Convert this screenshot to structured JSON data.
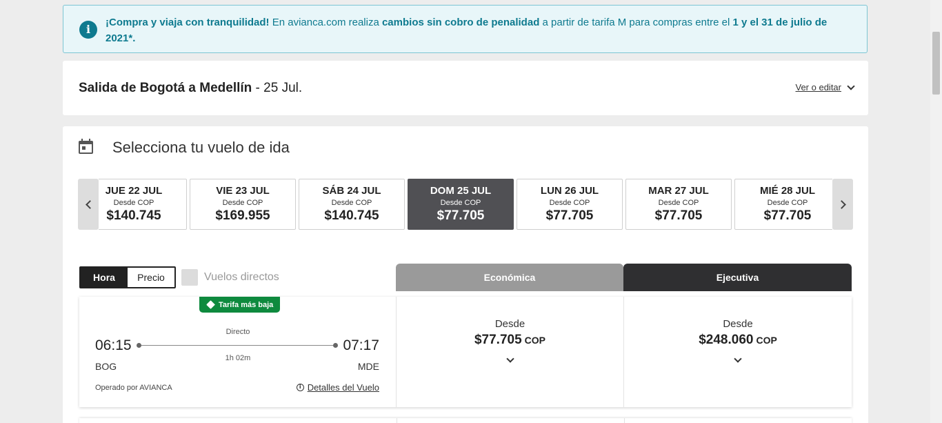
{
  "banner": {
    "part1": "¡Compra y viaja con tranquilidad!",
    "part2": " En avianca.com realiza ",
    "part3": "cambios sin cobro de penalidad",
    "part4": " a partir de tarifa M para compras entre el ",
    "part5": "1 y el 31 de julio de 2021*.",
    "icon": "info-icon",
    "color": "#0e7a8f"
  },
  "route": {
    "title": "Salida de Bogotá a Medellín",
    "date": " - 25 Jul.",
    "edit_label": "Ver o editar"
  },
  "selection": {
    "title": "Selecciona tu vuelo de ida",
    "dates": [
      {
        "day": "JUE 22 JUL",
        "from": "Desde COP",
        "price": "$140.745"
      },
      {
        "day": "VIE 23 JUL",
        "from": "Desde COP",
        "price": "$169.955"
      },
      {
        "day": "SÁB 24 JUL",
        "from": "Desde COP",
        "price": "$140.745"
      },
      {
        "day": "DOM 25 JUL",
        "from": "Desde COP",
        "price": "$77.705"
      },
      {
        "day": "LUN 26 JUL",
        "from": "Desde COP",
        "price": "$77.705"
      },
      {
        "day": "MAR 27 JUL",
        "from": "Desde COP",
        "price": "$77.705"
      },
      {
        "day": "MIÉ 28 JUL",
        "from": "Desde COP",
        "price": "$77.705"
      }
    ],
    "selected_date": "DOM 25 JUL"
  },
  "filters": {
    "sort_time": "Hora",
    "sort_price": "Precio",
    "active_sort": "Hora",
    "direct_label": "Vuelos directos",
    "direct_checked": false
  },
  "cabins": {
    "economy": "Económica",
    "executive": "Ejecutiva"
  },
  "flight": {
    "badge": "Tarifa más baja",
    "stops": "Directo",
    "departure_time": "06:15",
    "arrival_time": "07:17",
    "duration": "1h 02m",
    "origin": "BOG",
    "destination": "MDE",
    "operator": "Operado por AVIANCA",
    "details_label": "Detalles del Vuelo",
    "economy": {
      "from": "Desde",
      "price": "$77.705",
      "currency": "COP"
    },
    "executive": {
      "from": "Desde",
      "price": "$248.060",
      "currency": "COP"
    }
  },
  "colors": {
    "badge_green": "#0e8a3e",
    "selected_date_bg": "#505054",
    "economy_tab": "#9a9a9a",
    "executive_tab": "#2f2f31"
  }
}
